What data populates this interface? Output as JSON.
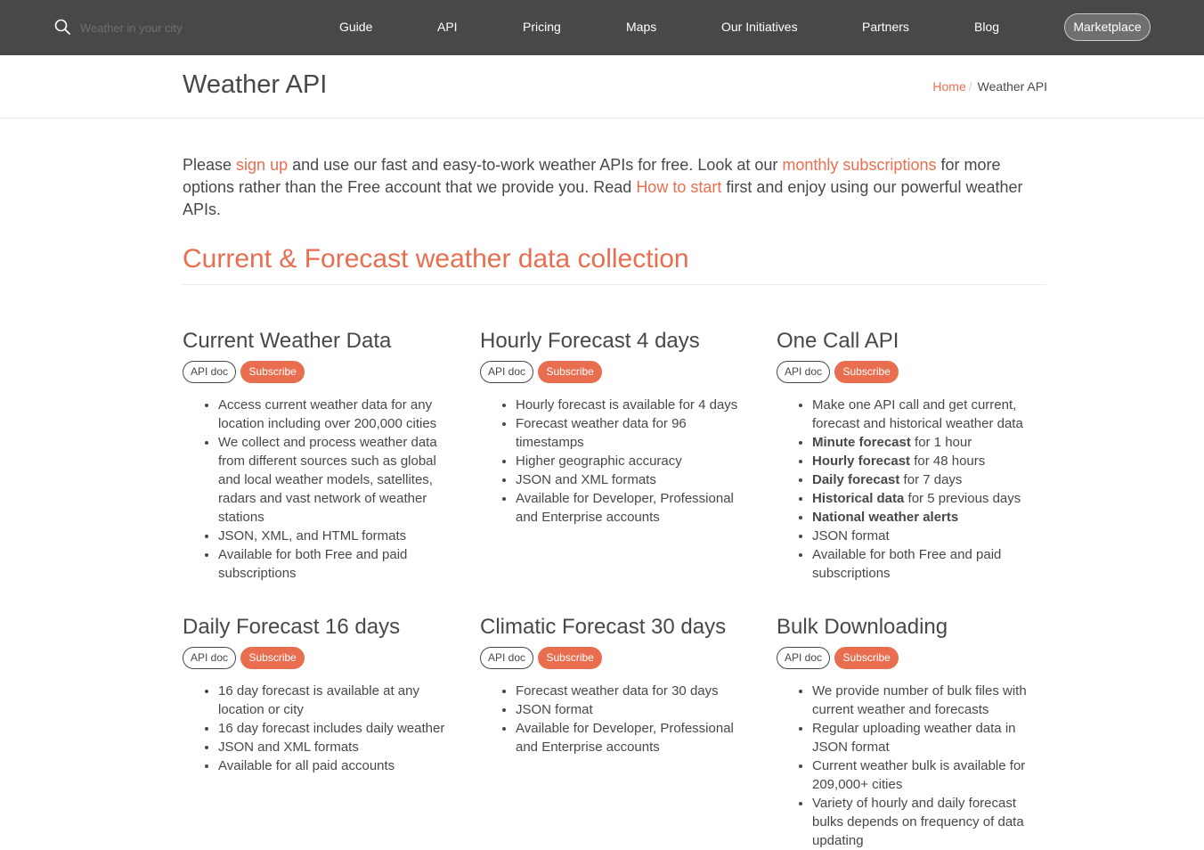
{
  "nav": {
    "search_placeholder": "Weather in your city",
    "items": [
      "Guide",
      "API",
      "Pricing",
      "Maps",
      "Our Initiatives",
      "Partners",
      "Blog"
    ],
    "marketplace": "Marketplace"
  },
  "page": {
    "title": "Weather API",
    "breadcrumb": {
      "home": "Home",
      "separator": "/",
      "current": "Weather API"
    }
  },
  "intro": {
    "t1": "Please ",
    "link_signup": "sign up",
    "t2": " and use our fast and easy-to-work weather APIs for free. Look at our ",
    "link_subscriptions": "monthly subscriptions",
    "t3": " for more options rather than the Free account that we provide you. Read ",
    "link_howto": "How to start",
    "t4": " first and enjoy using our powerful weather APIs."
  },
  "section_title": "Current & Forecast weather data collection",
  "buttons": {
    "api_doc": "API doc",
    "subscribe": "Subscribe"
  },
  "cards": [
    {
      "title": "Current Weather Data",
      "items": [
        {
          "text": "Access current weather data for any location including over 200,000 cities"
        },
        {
          "text": "We collect and process weather data from different sources such as global and local weather models, satellites, radars and vast network of weather stations"
        },
        {
          "text": "JSON, XML, and HTML formats"
        },
        {
          "text": "Available for both Free and paid subscriptions"
        }
      ]
    },
    {
      "title": "Hourly Forecast 4 days",
      "items": [
        {
          "text": "Hourly forecast is available for 4 days"
        },
        {
          "text": "Forecast weather data for 96 timestamps"
        },
        {
          "text": "Higher geographic accuracy"
        },
        {
          "text": "JSON and XML formats"
        },
        {
          "text": "Available for Developer, Professional and Enterprise accounts"
        }
      ]
    },
    {
      "title": "One Call API",
      "items": [
        {
          "text": "Make one API call and get current, forecast and historical weather data"
        },
        {
          "bold": "Minute forecast",
          "text": " for 1 hour"
        },
        {
          "bold": "Hourly forecast",
          "text": " for 48 hours"
        },
        {
          "bold": "Daily forecast",
          "text": " for 7 days"
        },
        {
          "bold": "Historical data",
          "text": " for 5 previous days"
        },
        {
          "bold": "National weather alerts",
          "text": ""
        },
        {
          "text": "JSON format"
        },
        {
          "text": "Available for both Free and paid subscriptions"
        }
      ]
    },
    {
      "title": "Daily Forecast 16 days",
      "items": [
        {
          "text": "16 day forecast is available at any location or city"
        },
        {
          "text": "16 day forecast includes daily weather"
        },
        {
          "text": "JSON and XML formats"
        },
        {
          "text": "Available for all paid accounts"
        }
      ]
    },
    {
      "title": "Climatic Forecast 30 days",
      "items": [
        {
          "text": "Forecast weather data for 30 days"
        },
        {
          "text": "JSON format"
        },
        {
          "text": "Available for Developer, Professional and Enterprise accounts"
        }
      ]
    },
    {
      "title": "Bulk Downloading",
      "items": [
        {
          "text": "We provide number of bulk files with current weather and forecasts"
        },
        {
          "text": "Regular uploading weather data in JSON format"
        },
        {
          "text": "Current weather bulk is available for 209,000+ cities"
        },
        {
          "text": "Variety of hourly and daily forecast bulks depends on frequency of data updating"
        }
      ]
    }
  ],
  "colors": {
    "header_bg": "#48484a",
    "accent": "#e96e50",
    "text": "#48484a"
  }
}
